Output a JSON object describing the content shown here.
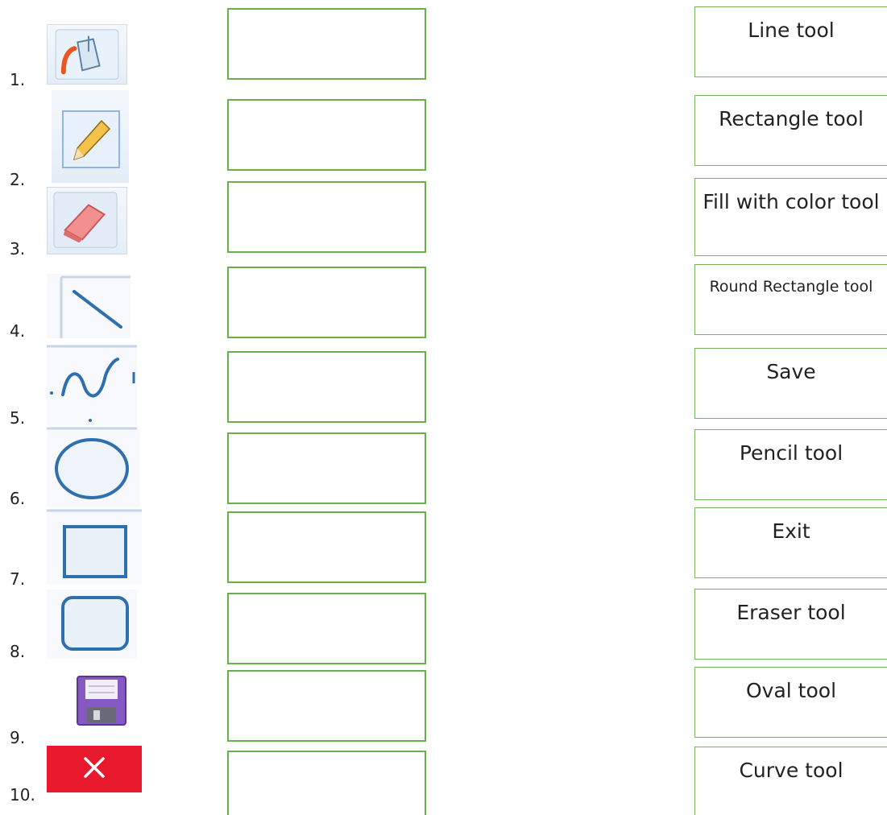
{
  "items": [
    {
      "number": "1.",
      "icon": "fill-bucket-icon"
    },
    {
      "number": "2.",
      "icon": "pencil-icon"
    },
    {
      "number": "3.",
      "icon": "eraser-icon"
    },
    {
      "number": "4.",
      "icon": "line-icon"
    },
    {
      "number": "5.",
      "icon": "curve-icon"
    },
    {
      "number": "6.",
      "icon": "oval-icon"
    },
    {
      "number": "7.",
      "icon": "rectangle-icon"
    },
    {
      "number": "8.",
      "icon": "round-rectangle-icon"
    },
    {
      "number": "9.",
      "icon": "save-floppy-icon"
    },
    {
      "number": "10.",
      "icon": "close-icon"
    }
  ],
  "labels": [
    "Line tool",
    "Rectangle tool",
    "Fill with color tool",
    "Round Rectangle tool",
    "Save",
    "Pencil tool",
    "Exit",
    "Eraser tool",
    "Oval tool",
    "Curve tool"
  ],
  "colors": {
    "box_border": "#6aaf4a",
    "icon_blue": "#2f6fae",
    "exit_red": "#e8192c",
    "save_purple": "#7d4fb8"
  }
}
